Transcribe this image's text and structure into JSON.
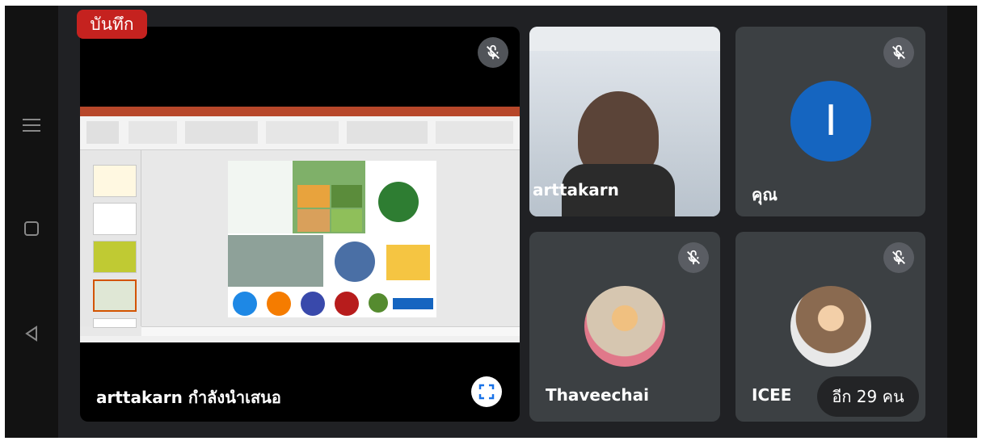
{
  "recording": {
    "label": "บันทึก"
  },
  "presenter": {
    "name": "arttakarn",
    "status_label": "arttakarn กำลังนำเสนอ"
  },
  "participants": [
    {
      "name": "arttakarn"
    },
    {
      "name": "คุณ",
      "avatar_initial": "I",
      "avatar_color": "#1565c0"
    },
    {
      "name": "Thaveechai"
    },
    {
      "name": "ICEE"
    }
  ],
  "more_participants": {
    "label": "อีก 29 คน"
  },
  "colors": {
    "background": "#202124",
    "tile": "#3c4043",
    "recording": "#c5221f"
  },
  "icons": [
    "menu-icon",
    "square-icon",
    "back-icon",
    "mic-off-icon",
    "fullscreen-icon"
  ]
}
